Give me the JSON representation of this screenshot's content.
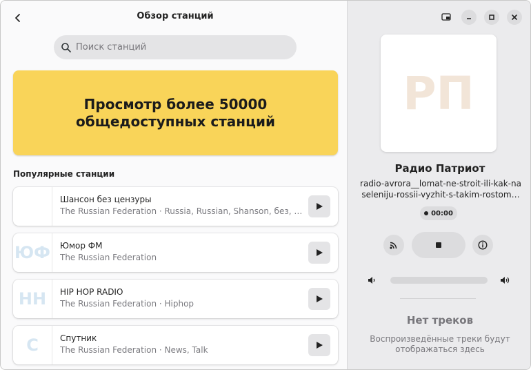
{
  "header": {
    "title": "Обзор станций"
  },
  "search": {
    "placeholder": "Поиск станций"
  },
  "banner": {
    "text": "Просмотр более 50000 общедоступных станций"
  },
  "popular": {
    "title": "Популярные станции",
    "stations": [
      {
        "initials": "",
        "name": "Шансон без цензуры",
        "meta": "The Russian Federation · Russia, Russian, Shanson, без, р…"
      },
      {
        "initials": "ЮФ",
        "name": "Юмор ФМ",
        "meta": "The Russian Federation"
      },
      {
        "initials": "HH",
        "name": "HIP HOP RADIO",
        "meta": "The Russian Federation · Hiphop"
      },
      {
        "initials": "С",
        "name": "Спутник",
        "meta": "The Russian Federation · News, Talk"
      }
    ]
  },
  "player": {
    "cover_initials": "РП",
    "station_name": "Радио Патриот",
    "track": "radio-avrora__lomat-ne-stroit-ili-kak-naseleniju-rossii-vyzhit-s-takim-rostom…",
    "elapsed": "00:00",
    "volume_level": 0
  },
  "history": {
    "empty_title": "Нет треков",
    "empty_text": "Воспроизведённые треки будут отображаться здесь"
  },
  "colors": {
    "banner": "#f9d459",
    "sidebar_bg": "#ebebed",
    "pane_bg": "#fafafb"
  },
  "icons": [
    "back-arrow-icon",
    "search-icon",
    "play-icon",
    "picture-in-picture-icon",
    "minimize-icon",
    "maximize-icon",
    "close-icon",
    "cast-icon",
    "stop-icon",
    "info-icon",
    "volume-low-icon",
    "volume-high-icon"
  ]
}
